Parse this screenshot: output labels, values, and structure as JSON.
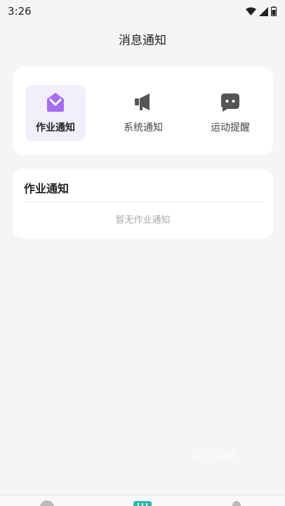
{
  "status_bar": {
    "time": "3:26"
  },
  "nav": {
    "title": "消息通知"
  },
  "tabs": [
    {
      "label": "作业通知",
      "icon": "homework-envelope-icon",
      "active": true
    },
    {
      "label": "系统通知",
      "icon": "megaphone-icon",
      "active": false
    },
    {
      "label": "运动提醒",
      "icon": "chat-bubble-icon",
      "active": false
    }
  ],
  "list": {
    "title": "作业通知",
    "empty_text": "暂无作业通知"
  },
  "watermark": "321手游网",
  "colors": {
    "accent": "#a56ef0",
    "active_tab_bg": "#f3eefc",
    "icon_gray": "#555555",
    "page_bg": "#f5f5f7"
  }
}
